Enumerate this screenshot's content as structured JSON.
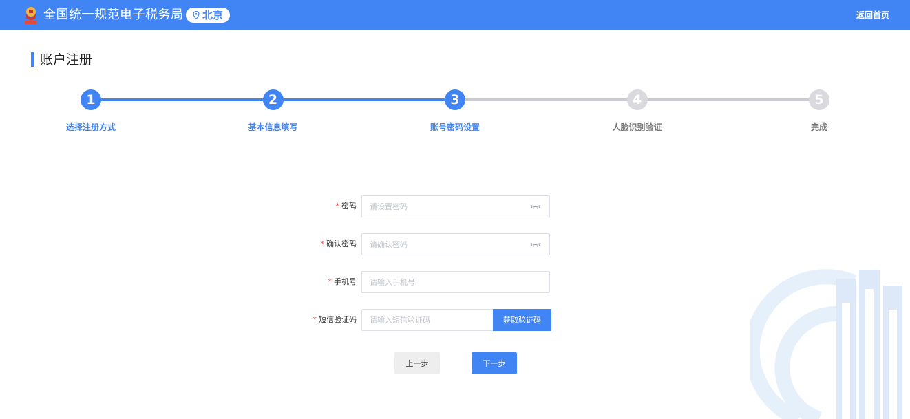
{
  "colors": {
    "brand": "#4185f5",
    "step_active": "#4185f5",
    "step_inactive": "#d9d9de",
    "line_inactive": "#c9cad2",
    "label_inactive": "#777777",
    "required": "#f14d4d"
  },
  "header": {
    "logo_icon": "tax-emblem-icon",
    "title": "全国统一规范电子税务局",
    "location_icon": "location-pin-icon",
    "city": "北京",
    "back_home": "返回首页"
  },
  "page": {
    "title": "账户注册"
  },
  "stepper": {
    "current": 3,
    "steps": [
      {
        "number": "1",
        "label": "选择注册方式"
      },
      {
        "number": "2",
        "label": "基本信息填写"
      },
      {
        "number": "3",
        "label": "账号密码设置"
      },
      {
        "number": "4",
        "label": "人脸识别验证"
      },
      {
        "number": "5",
        "label": "完成"
      }
    ]
  },
  "form": {
    "required_mark": "*",
    "password": {
      "label": "密码",
      "value": "",
      "placeholder": "请设置密码",
      "toggle_icon": "eye-closed-icon"
    },
    "confirm_password": {
      "label": "确认密码",
      "value": "",
      "placeholder": "请确认密码",
      "toggle_icon": "eye-closed-icon"
    },
    "phone": {
      "label": "手机号",
      "value": "",
      "placeholder": "请输入手机号"
    },
    "sms_code": {
      "label": "短信验证码",
      "value": "",
      "placeholder": "请输入短信验证码",
      "button": "获取验证码"
    }
  },
  "actions": {
    "prev": "上一步",
    "next": "下一步"
  }
}
